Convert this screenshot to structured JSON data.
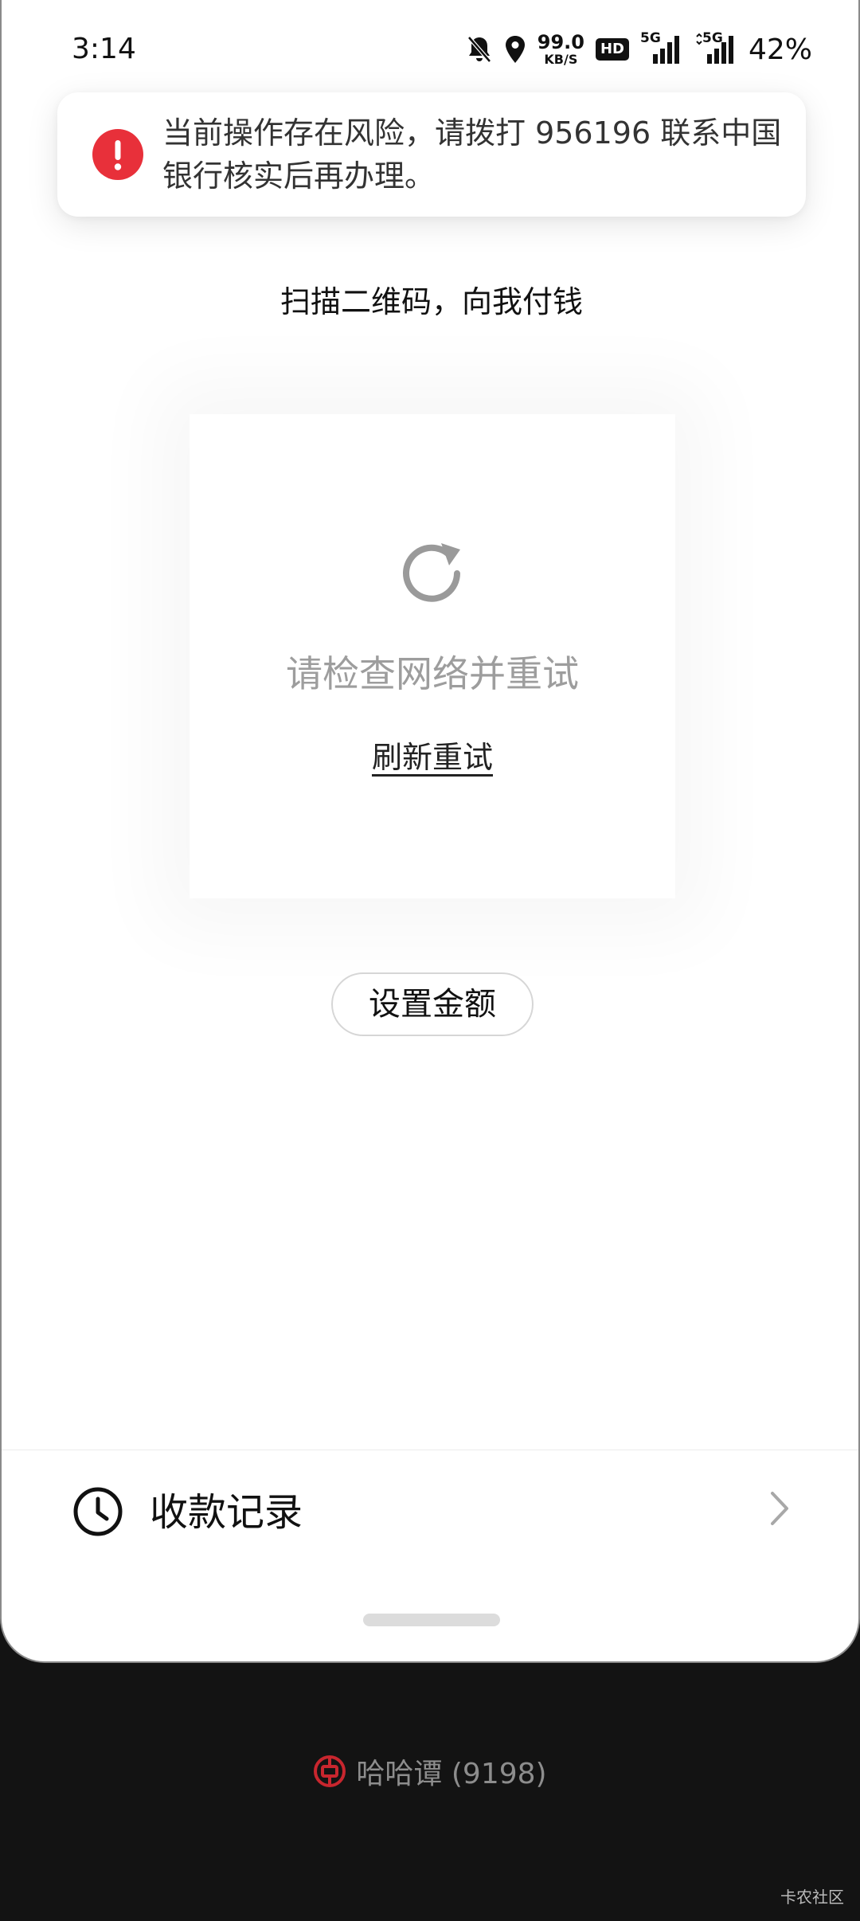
{
  "status_bar": {
    "time": "3:14",
    "net_speed_value": "99.0",
    "net_speed_unit": "KB/S",
    "hd_badge": "HD",
    "signal_1_label": "5G",
    "signal_2_label": "5G",
    "battery": "42%",
    "icons": [
      "bell-muted-icon",
      "location-icon",
      "hd-icon",
      "signal-icon",
      "signal-icon"
    ]
  },
  "toast": {
    "message": "当前操作存在风险，请拨打 956196 联系中国银行核实后再办理。",
    "icon": "exclamation-icon",
    "accent": "#e8303a"
  },
  "scan_title": "扫描二维码，向我付钱",
  "qr": {
    "error_message": "请检查网络并重试",
    "retry_label": "刷新重试",
    "icon": "refresh-icon"
  },
  "set_amount_label": "设置金额",
  "records": {
    "label": "收款记录",
    "icon": "clock-icon",
    "chevron": "chevron-right-icon"
  },
  "account": {
    "name": "哈哈谭 (9198)",
    "logo": "boc-logo",
    "logo_color": "#c8262e"
  },
  "watermark": "卡农社区"
}
